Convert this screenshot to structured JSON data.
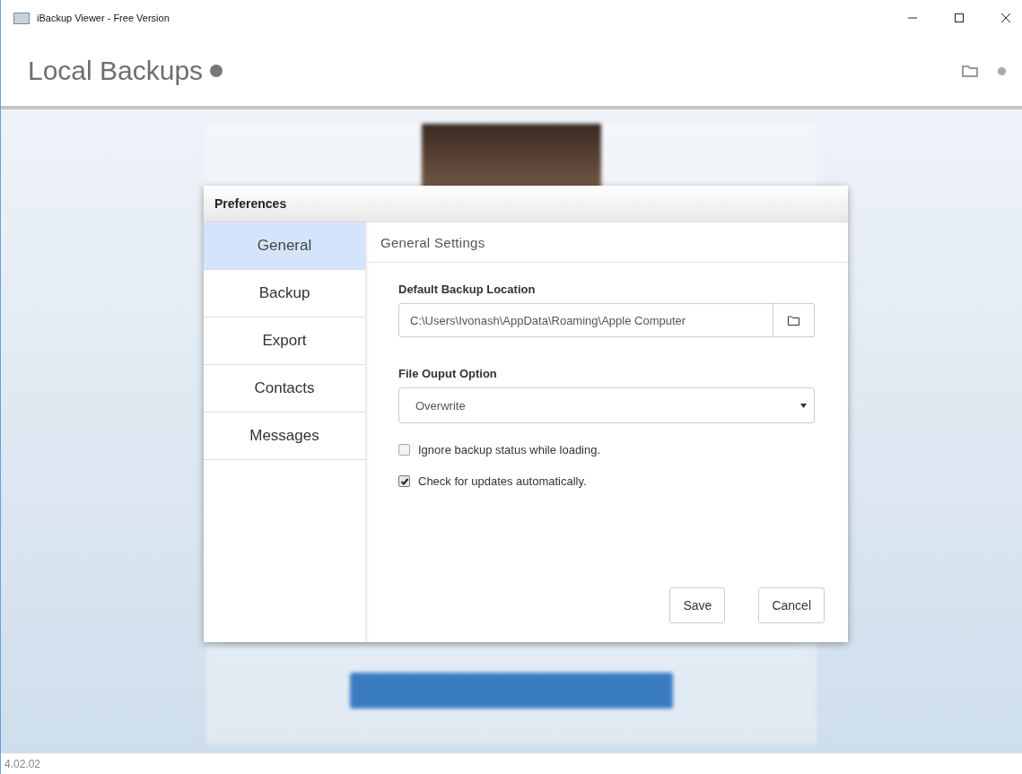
{
  "window": {
    "title": "iBackup Viewer - Free Version"
  },
  "header": {
    "title": "Local Backups"
  },
  "dialog": {
    "title": "Preferences",
    "nav": [
      {
        "label": "General",
        "selected": true
      },
      {
        "label": "Backup",
        "selected": false
      },
      {
        "label": "Export",
        "selected": false
      },
      {
        "label": "Contacts",
        "selected": false
      },
      {
        "label": "Messages",
        "selected": false
      }
    ],
    "section_title": "General Settings",
    "location": {
      "label": "Default Backup Location",
      "value": "C:\\Users\\Ivonash\\AppData\\Roaming\\Apple Computer"
    },
    "output": {
      "label": "File Ouput Option",
      "value": "Overwrite"
    },
    "options": [
      {
        "label": "Ignore backup status while loading.",
        "checked": false
      },
      {
        "label": "Check for updates automatically.",
        "checked": true
      }
    ],
    "buttons": [
      "Save",
      "Cancel"
    ]
  },
  "status_bar": {
    "version": "4.02.02"
  }
}
